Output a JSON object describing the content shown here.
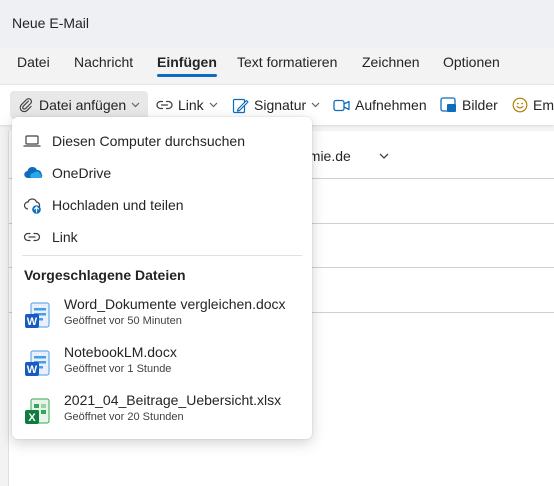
{
  "window": {
    "title": "Neue E-Mail"
  },
  "menu": {
    "tabs": [
      {
        "label": "Datei"
      },
      {
        "label": "Nachricht"
      },
      {
        "label": "Einfügen",
        "active": true
      },
      {
        "label": "Text formatieren"
      },
      {
        "label": "Zeichnen"
      },
      {
        "label": "Optionen"
      }
    ]
  },
  "ribbon": {
    "attach_file": "Datei anfügen",
    "link": "Link",
    "signature": "Signatur",
    "record": "Aufnehmen",
    "pictures": "Bilder",
    "emoji": "Em"
  },
  "compose": {
    "from_partial": "emie.de"
  },
  "dropdown": {
    "items": [
      {
        "label": "Diesen Computer durchsuchen",
        "icon": "laptop-icon"
      },
      {
        "label": "OneDrive",
        "icon": "onedrive-icon"
      },
      {
        "label": "Hochladen und teilen",
        "icon": "cloud-upload-icon"
      },
      {
        "label": "Link",
        "icon": "link-icon"
      }
    ],
    "suggested_title": "Vorgeschlagene Dateien",
    "files": [
      {
        "name": "Word_Dokumente vergleichen.docx",
        "opened": "Geöffnet vor 50 Minuten",
        "type": "word"
      },
      {
        "name": "NotebookLM.docx",
        "opened": "Geöffnet vor 1 Stunde",
        "type": "word"
      },
      {
        "name": "2021_04_Beitrage_Uebersicht.xlsx",
        "opened": "Geöffnet vor 20 Stunden",
        "type": "excel"
      }
    ]
  },
  "colors": {
    "accent": "#0f6cbd",
    "word": "#185abd",
    "excel": "#107c41"
  }
}
